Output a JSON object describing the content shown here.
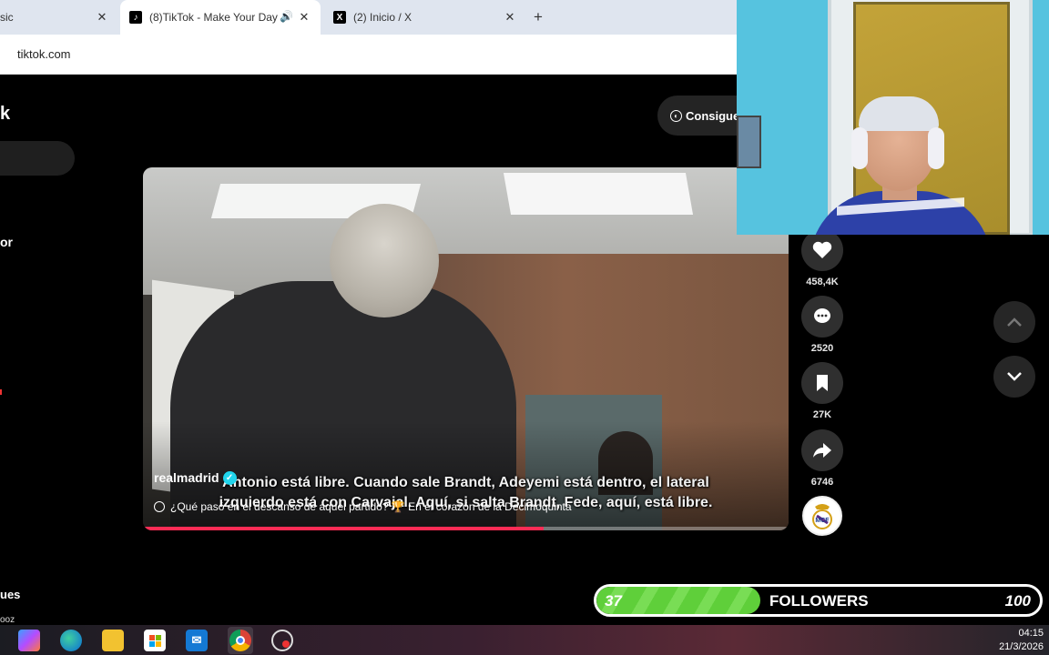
{
  "browser": {
    "tabs": [
      {
        "label": "sic",
        "active": false
      },
      {
        "label": "(8)TikTok - Make Your Day",
        "active": true
      },
      {
        "label": "(2) Inicio / X",
        "active": false
      }
    ],
    "new_tab": "+",
    "url": "tiktok.com"
  },
  "tiktok": {
    "logo_fragment": "k",
    "sidebar_fragment_1": "or",
    "sidebar_fragment_2": "ues",
    "sidebar_fragment_3": "ooz",
    "get_app_button": "Consigue"
  },
  "video": {
    "subtitle_line1": "Antonio está libre. Cuando sale Brandt, Adeyemi está dentro, el lateral",
    "subtitle_line2": "izquierdo está con Carvajal. Aquí, si salta Brandt, Fede, aquí, está libre.",
    "username": "realmadrid",
    "verified": true,
    "music": "¿Qué pasó en el descanso de aquel partido? 🏆 En el corazón de la Decimoquinta",
    "progress": 0.62
  },
  "actions": {
    "likes": "458,4K",
    "comments": "2520",
    "saves": "27K",
    "shares": "6746"
  },
  "followers_goal": {
    "current": "37",
    "label": "FOLLOWERS",
    "target": "100",
    "fill_fraction": 0.37,
    "color": "#5fcf3a"
  },
  "taskbar": {
    "icons": [
      "copilot-icon",
      "edge-icon",
      "file-explorer-icon",
      "store-icon",
      "mail-icon",
      "chrome-icon",
      "recorder-icon"
    ],
    "time": "04:15",
    "date": "21/3/2026"
  }
}
